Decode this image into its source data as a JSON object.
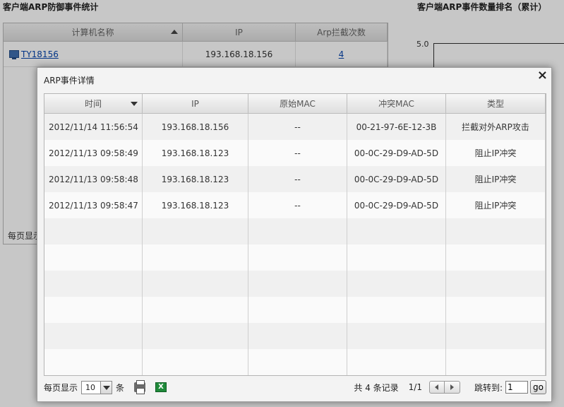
{
  "background": {
    "left_title": "客户端ARP防御事件统计",
    "right_title": "客户端ARP事件数量排名（累计）",
    "table": {
      "headers": [
        "计算机名称",
        "IP",
        "Arp拦截次数"
      ],
      "row": {
        "name": "TY18156",
        "ip": "193.168.18.156",
        "count": "4"
      },
      "footer_label": "每页显示"
    },
    "chart": {
      "y_tick": "5.0"
    }
  },
  "modal": {
    "title": "ARP事件详情",
    "close_label": "×",
    "headers": [
      "时间",
      "IP",
      "原始MAC",
      "冲突MAC",
      "类型"
    ],
    "rows": [
      [
        "2012/11/14 11:56:54",
        "193.168.18.156",
        "--",
        "00-21-97-6E-12-3B",
        "拦截对外ARP攻击"
      ],
      [
        "2012/11/13 09:58:49",
        "193.168.18.123",
        "--",
        "00-0C-29-D9-AD-5D",
        "阻止IP冲突"
      ],
      [
        "2012/11/13 09:58:48",
        "193.168.18.123",
        "--",
        "00-0C-29-D9-AD-5D",
        "阻止IP冲突"
      ],
      [
        "2012/11/13 09:58:47",
        "193.168.18.123",
        "--",
        "00-0C-29-D9-AD-5D",
        "阻止IP冲突"
      ]
    ],
    "pager": {
      "per_page_label": "每页显示",
      "per_page_value": "10",
      "per_page_unit": "条",
      "records": "共 4 条记录",
      "page": "1/1",
      "jump_label": "跳转到:",
      "jump_value": "1",
      "go_label": "go"
    },
    "icons": {
      "print": "print-icon",
      "excel": "excel-icon"
    }
  }
}
